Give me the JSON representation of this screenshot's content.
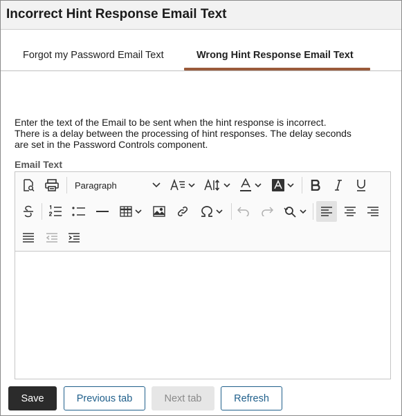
{
  "header": {
    "title": "Incorrect Hint Response Email Text"
  },
  "tabs": [
    {
      "label": "Forgot my Password Email Text",
      "selected": false
    },
    {
      "label": "Wrong Hint Response Email Text",
      "selected": true
    }
  ],
  "description": {
    "lines": [
      "Enter the text of the Email to be sent when the hint response is incorrect.",
      "There is a delay between the processing of hint responses. The delay seconds",
      "are set in the Password Controls component."
    ]
  },
  "email_text": {
    "label": "Email Text",
    "block_format": "Paragraph",
    "value": ""
  },
  "toolbar_icons": [
    "preview-icon",
    "print-icon",
    "font-size-icon",
    "font-family-icon",
    "text-color-icon",
    "background-color-icon",
    "bold-icon",
    "italic-icon",
    "underline-icon",
    "strikethrough-icon",
    "numbered-list-icon",
    "bulleted-list-icon",
    "horizontal-line-icon",
    "table-icon",
    "image-icon",
    "link-icon",
    "special-character-icon",
    "undo-icon",
    "redo-icon",
    "find-replace-icon",
    "align-left-icon",
    "align-center-icon",
    "align-right-icon",
    "justify-icon",
    "outdent-icon",
    "indent-icon"
  ],
  "buttons": {
    "save": "Save",
    "previous_tab": "Previous tab",
    "next_tab": "Next tab",
    "refresh": "Refresh"
  },
  "colors": {
    "tab_accent": "#9a5a3a",
    "primary_button": "#2b2b2b",
    "link_blue": "#1f5f8b"
  }
}
